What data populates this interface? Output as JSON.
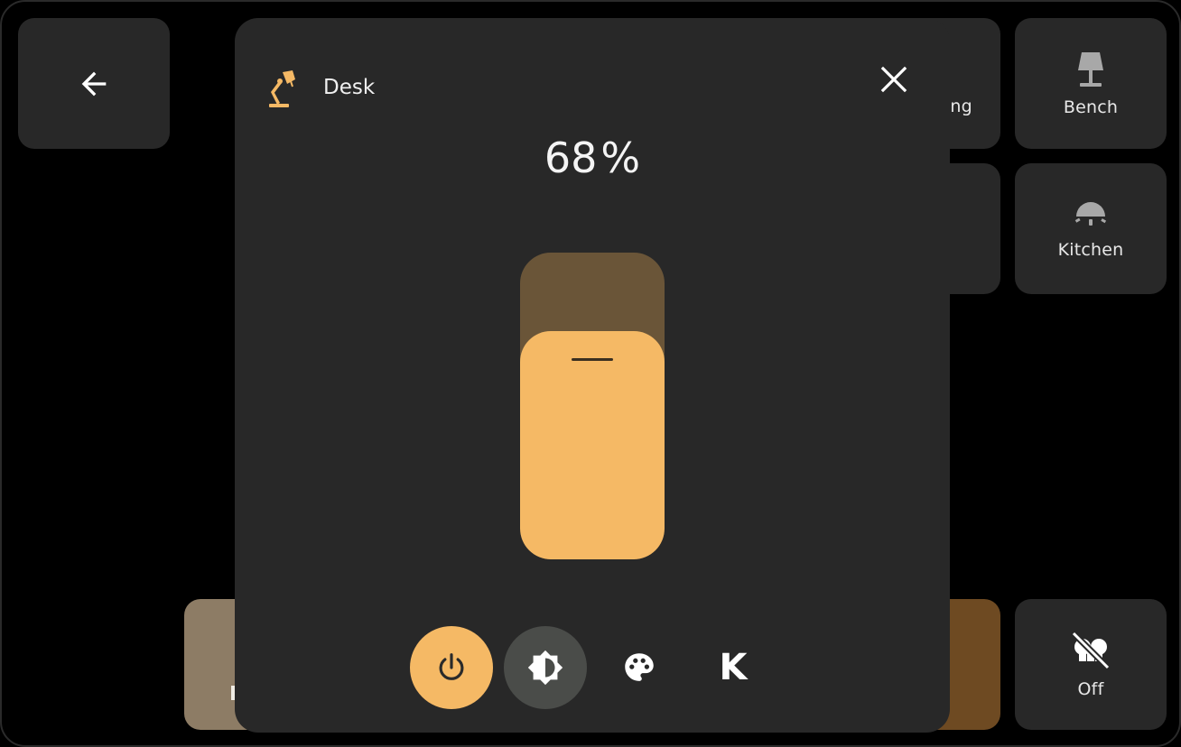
{
  "tiles": {
    "back": {
      "icon": "arrow-left-icon"
    },
    "ceiling": {
      "label": "iling",
      "icon": "ceiling-light-icon"
    },
    "bench": {
      "label": "Bench",
      "icon": "floor-lamp-icon"
    },
    "kitchen": {
      "label": "Kitchen",
      "icon": "pendant-light-icon"
    },
    "off": {
      "label": "Off",
      "icon": "lightbulb-group-off-icon"
    }
  },
  "dialog": {
    "title": "Desk",
    "icon": "desk-lamp-icon",
    "brightness_value": "68",
    "brightness_unit": "%",
    "brightness_fraction": 0.68,
    "controls": {
      "power": {
        "icon": "power-icon",
        "active": true
      },
      "brightness": {
        "icon": "brightness-icon",
        "selected": true
      },
      "color": {
        "icon": "palette-icon"
      },
      "temperature": {
        "icon": "kelvin-icon",
        "label": "K"
      }
    }
  },
  "colors": {
    "accent": "#f5b965",
    "slider_track": "#6a5538",
    "tile_bg": "#282828",
    "warm_tile": "#6e4a22",
    "beige_tile": "#8d7c65"
  }
}
